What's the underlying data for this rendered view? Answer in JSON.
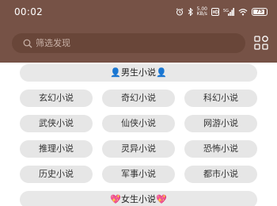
{
  "status_bar": {
    "time": "00:02",
    "net_speed_value": "5.00",
    "net_speed_unit": "KB/s",
    "battery": "75"
  },
  "search": {
    "placeholder": "筛选发现"
  },
  "colors": {
    "header_bg": "#765246",
    "search_bg": "#694639",
    "tag_bg": "#e6e6e6"
  },
  "sections": [
    {
      "title": "👤男生小说👤",
      "tags": [
        "玄幻小说",
        "奇幻小说",
        "科幻小说",
        "武侠小说",
        "仙侠小说",
        "网游小说",
        "推理小说",
        "灵异小说",
        "恐怖小说",
        "历史小说",
        "军事小说",
        "都市小说"
      ]
    },
    {
      "title": "💖女生小说💖"
    }
  ]
}
